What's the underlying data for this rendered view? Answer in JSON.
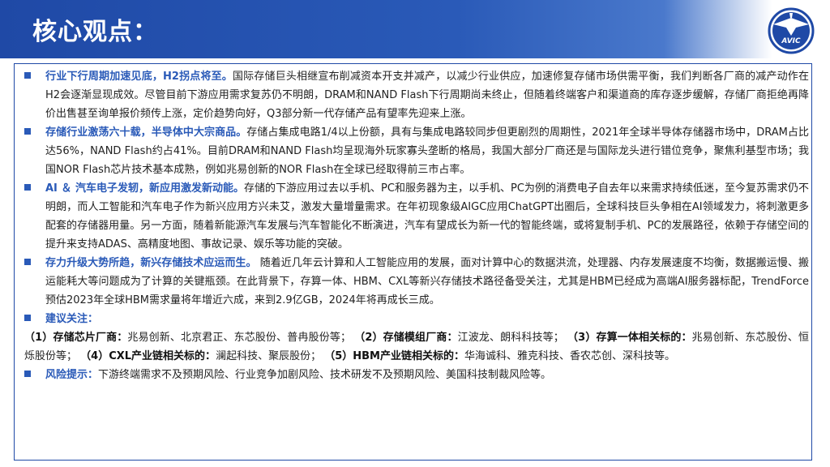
{
  "header": {
    "title": "核心观点："
  },
  "logo": {
    "text": "AVIC"
  },
  "sections": [
    {
      "heading": "行业下行周期加速见底，H2拐点将至。",
      "body": "国际存储巨头相继宣布削减资本开支并减产，以减少行业供应，加速修复存储市场供需平衡，我们判断各厂商的减产动作在H2会逐渐显现成效。尽管目前下游应用需求复苏仍不明朗，DRAM和NAND Flash下行周期尚未终止，但随着终端客户和渠道商的库存逐步缓解，存储厂商拒绝再降价出售甚至询单报价频传上涨，定价趋势向好，Q3部分新一代存储产品有望率先迎来上涨。"
    },
    {
      "heading": "存储行业激荡六十载，半导体中大宗商品。",
      "body": "存储占集成电路1/4以上份额，具有与集成电路较同步但更剧烈的周期性，2021年全球半导体存储器市场中，DRAM占比达56%，NAND Flash约占41%。目前DRAM和NAND Flash均呈现海外玩家寡头垄断的格局，我国大部分厂商还是与国际龙头进行错位竞争，聚焦利基型市场；我国NOR Flash芯片技术基本成熟，例如兆易创新的NOR Flash在全球已经取得前三市占率。"
    },
    {
      "heading": "AI ＆ 汽车电子发轫，新应用激发新动能。",
      "body": "存储的下游应用过去以手机、PC和服务器为主，以手机、PC为例的消费电子自去年以来需求持续低迷，至今复苏需求仍不明朗，而人工智能和汽车电子作为新兴应用方兴未艾，激发大量增量需求。在年初现象级AIGC应用ChatGPT出圈后，全球科技巨头争相在AI领域发力，将刺激更多配套的存储器用量。另一方面，随着新能源汽车发展与汽车智能化不断演进，汽车有望成长为新一代的智能终端，或将复制手机、PC的发展路径，依赖于存储空间的提升来支持ADAS、高精度地图、事故记录、娱乐等功能的突破。"
    },
    {
      "heading": "存力升级大势所趋，新兴存储技术应运而生。",
      "body": " 随着近几年云计算和人工智能应用的发展，面对计算中心的数据洪流，处理器、内存发展速度不均衡，数据搬运慢、搬运能耗大等问题成为了计算的关键瓶颈。在此背景下，存算一体、HBM、CXL等新兴存储技术路径备受关注，尤其是HBM已经成为高端AI服务器标配，TrendForce预估2023年全球HBM需求量将年增近六成，来到2.9亿GB，2024年将再成长三成。"
    }
  ],
  "recommend": {
    "heading": "建议关注：",
    "items": [
      {
        "num": "（1）",
        "label": "存储芯片厂商：",
        "text": "兆易创新、北京君正、东芯股份、普冉股份等；"
      },
      {
        "num": "（2）",
        "label": "存储模组厂商：",
        "text": "江波龙、朗科科技等；"
      },
      {
        "num": "（3）",
        "label": "存算一体相关标的：",
        "text": "兆易创新、东芯股份、恒烁股份等；"
      },
      {
        "num": "（4）",
        "label": "CXL产业链相关标的：",
        "text": "澜起科技、聚辰股份；"
      },
      {
        "num": "（5）",
        "label": "HBM产业链相关标的：",
        "text": "华海诚科、雅克科技、香农芯创、深科技等。"
      }
    ]
  },
  "risk": {
    "heading": "风险提示：",
    "body": "下游终端需求不及预期风险、行业竞争加剧风险、技术研发不及预期风险、美国科技制裁风险等。"
  },
  "colors": {
    "accent": "#2a5ab8",
    "header": "#1f49a6",
    "text": "#222222"
  }
}
